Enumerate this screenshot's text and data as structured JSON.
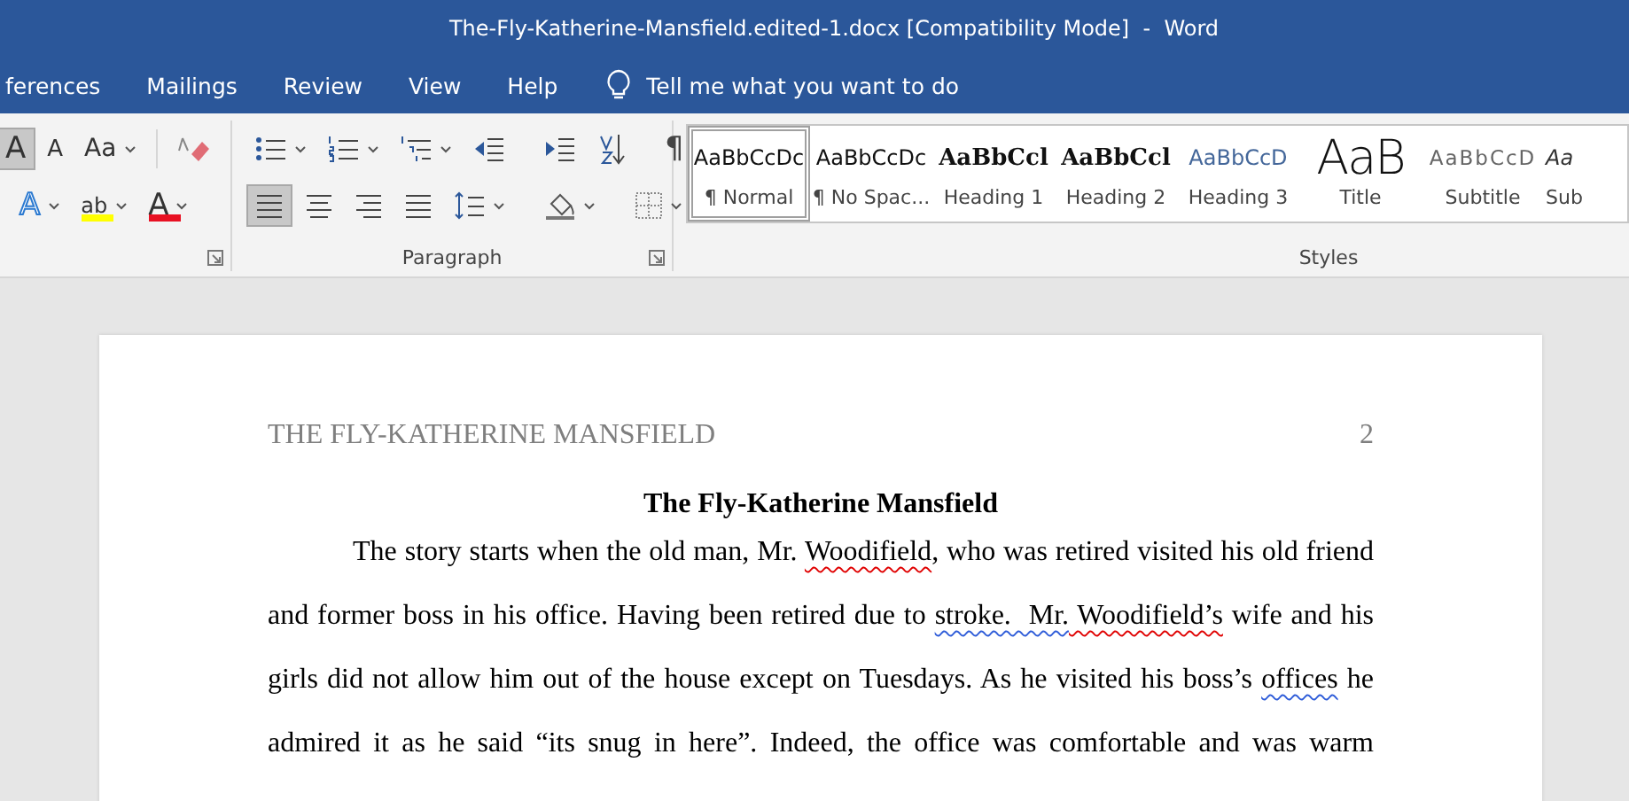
{
  "window": {
    "title": "The-Fly-Katherine-Mansfield.edited-1.docx [Compatibility Mode]  -  Word"
  },
  "tabs": [
    {
      "label": "ferences"
    },
    {
      "label": "Mailings"
    },
    {
      "label": "Review"
    },
    {
      "label": "View"
    },
    {
      "label": "Help"
    }
  ],
  "tell_me": {
    "placeholder": "Tell me what you want to do"
  },
  "font_group": {
    "row_1": [
      {
        "kind": "grow",
        "glyph": "A",
        "selected": true
      },
      {
        "kind": "shrink",
        "glyph": "A",
        "selected": false
      },
      {
        "kind": "case",
        "glyph": "Aa",
        "selected": false
      },
      {
        "kind": "clear",
        "selected": false
      }
    ],
    "row_2": [
      {
        "kind": "effects",
        "glyph": "A",
        "selected": false
      },
      {
        "kind": "highlight",
        "glyph": "ab",
        "selected": false,
        "color": "#ffff00"
      },
      {
        "kind": "font-color",
        "glyph": "A",
        "selected": false,
        "color": "#e81123"
      }
    ]
  },
  "paragraph_group": {
    "label": "Paragraph",
    "row_1": [
      {
        "kind": "bullets",
        "selected": false
      },
      {
        "kind": "numbering",
        "selected": false
      },
      {
        "kind": "multilevel",
        "selected": false
      },
      {
        "kind": "outdent",
        "selected": false
      },
      {
        "kind": "indent",
        "selected": false
      },
      {
        "kind": "sort",
        "selected": false
      },
      {
        "kind": "marks",
        "glyph": "¶",
        "selected": false
      }
    ],
    "row_2": [
      {
        "kind": "align-left",
        "selected": true
      },
      {
        "kind": "center",
        "selected": false
      },
      {
        "kind": "align-right",
        "selected": false
      },
      {
        "kind": "justify",
        "selected": false
      },
      {
        "kind": "spacing",
        "selected": false
      },
      {
        "kind": "shading",
        "selected": false
      },
      {
        "kind": "borders",
        "selected": false
      }
    ]
  },
  "styles_group": {
    "label": "Styles",
    "styles": [
      {
        "kind": "normal",
        "preview": "AaBbCcDc",
        "label": "¶ Normal",
        "selected": true
      },
      {
        "kind": "nospacing",
        "preview": "AaBbCcDc",
        "label": "¶ No Spac...",
        "selected": false
      },
      {
        "kind": "heading1",
        "preview": "AaBbCcl",
        "label": "Heading 1",
        "selected": false
      },
      {
        "kind": "heading2",
        "preview": "AaBbCcl",
        "label": "Heading 2",
        "selected": false
      },
      {
        "kind": "heading3",
        "preview": "AaBbCcD",
        "label": "Heading 3",
        "selected": false
      },
      {
        "kind": "title",
        "preview": "AaB",
        "label": "Title",
        "selected": false
      },
      {
        "kind": "subtitle",
        "preview": "AaBbCcD",
        "label": "Subtitle",
        "selected": false
      },
      {
        "kind": "subtle",
        "preview": "Aa",
        "label": "Sub",
        "selected": false
      }
    ]
  },
  "document": {
    "header": "THE FLY-KATHERINE MANSFIELD",
    "page_number": "2",
    "title": "The Fly-Katherine Mansfield",
    "lines": [
      [
        {
          "text": "The story starts when the old man, Mr. ",
          "spelling_error": false,
          "grammar_error": false
        },
        {
          "text": "Woodifield",
          "spelling_error": true,
          "grammar_error": false
        },
        {
          "text": ", who was retired visited his old friend",
          "spelling_error": false,
          "grammar_error": false
        }
      ],
      [
        {
          "text": "and former boss in his office. Having been retired due to ",
          "spelling_error": false,
          "grammar_error": false
        },
        {
          "text": "stroke.  Mr.",
          "spelling_error": false,
          "grammar_error": true
        },
        {
          "text": " Woodifield’s",
          "spelling_error": true,
          "grammar_error": false
        },
        {
          "text": " wife and his",
          "spelling_error": false,
          "grammar_error": false
        }
      ],
      [
        {
          "text": "girls did not allow him out of the house except on Tuesdays. As he visited his boss’s ",
          "spelling_error": false,
          "grammar_error": false
        },
        {
          "text": "offices",
          "spelling_error": false,
          "grammar_error": true
        },
        {
          "text": " he",
          "spelling_error": false,
          "grammar_error": false
        }
      ],
      [
        {
          "text": "admired it as he said “its snug in here”. Indeed, the office was comfortable and was warm",
          "spelling_error": false,
          "grammar_error": false
        }
      ]
    ]
  }
}
